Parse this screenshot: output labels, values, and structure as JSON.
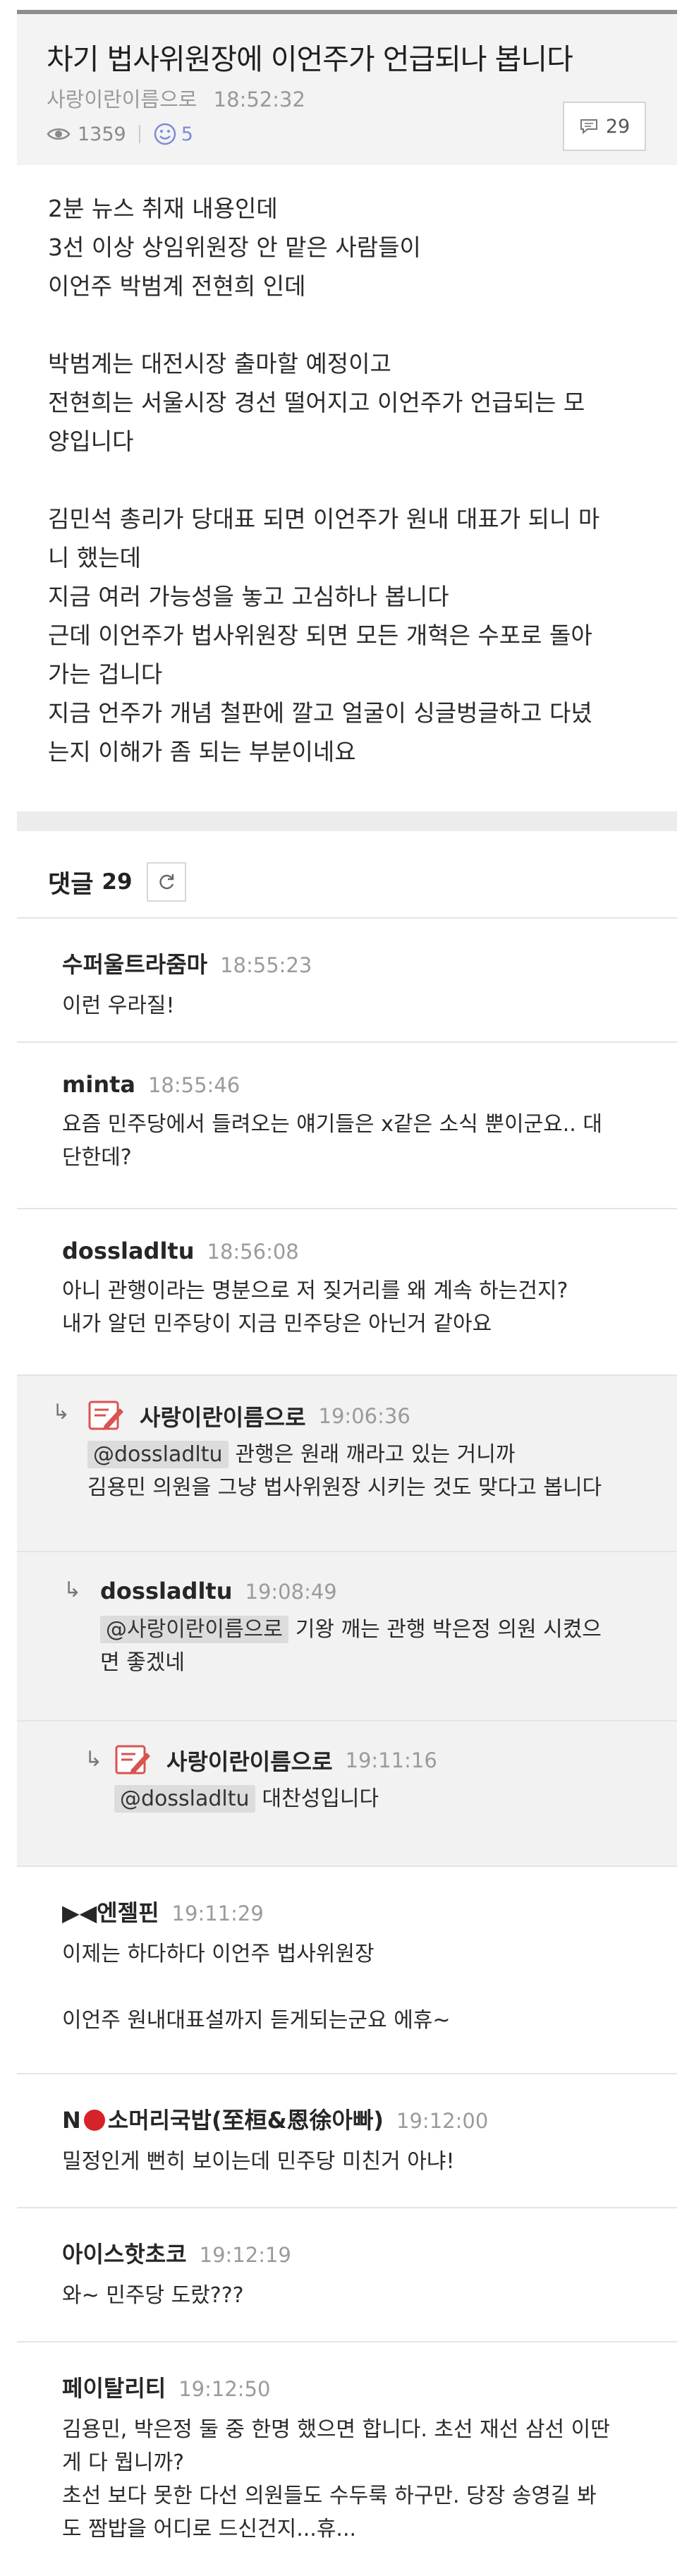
{
  "post": {
    "title": "차기 법사위원장에 이언주가 언급되나 봅니다",
    "author": "사랑이란이름으로",
    "time": "18:52:32",
    "views": "1359",
    "likes": "5",
    "comment_count": "29",
    "body": {
      "p1": [
        "2분 뉴스 취재 내용인데",
        "3선 이상 상임위원장 안 맡은 사람들이",
        "이언주 박범계 전현희 인데"
      ],
      "p2": [
        "박범계는 대전시장 출마할 예정이고",
        "전현희는 서울시장 경선 떨어지고 이언주가 언급되는 모",
        "양입니다"
      ],
      "p3": [
        "김민석 총리가 당대표 되면 이언주가 원내 대표가 되니 마",
        "니 했는데",
        "지금 여러 가능성을 놓고 고심하나 봅니다",
        "근데 이언주가 법사위원장 되면 모든 개혁은 수포로 돌아",
        "가는 겁니다",
        "지금 언주가 개념 철판에 깔고 얼굴이 싱글벙글하고 다녔",
        "는지 이해가 좀 되는 부분이네요"
      ]
    }
  },
  "comments_header": {
    "title": "댓글",
    "count": "29"
  },
  "comments": [
    {
      "name": "수퍼울트라줌마",
      "time": "18:55:23",
      "lines": [
        "이런 우라질!"
      ]
    },
    {
      "name": "minta",
      "time": "18:55:46",
      "lines": [
        "요즘 민주당에서 들려오는 얘기들은 x같은 소식 뿐이군요.. 대",
        "단한데?"
      ]
    },
    {
      "name": "dossladltu",
      "time": "18:56:08",
      "lines": [
        "아니 관행이라는 명분으로 저 짖거리를 왜 계속 하는건지?",
        "내가 알던 민주당이 지금 민주당은 아닌거 같아요"
      ]
    },
    {
      "name": "사랑이란이름으로",
      "time": "19:06:36",
      "mention": "@dossladltu",
      "lines": [
        "관행은 원래 깨라고 있는 거니까",
        "김용민 의원을 그냥 법사위원장 시키는 것도 맞다고 봅니다"
      ]
    },
    {
      "name": "dossladltu",
      "time": "19:08:49",
      "mention": "@사랑이란이름으로",
      "lines": [
        "기왕 깨는 관행 박은정 의원 시켰으",
        "면 좋겠네"
      ]
    },
    {
      "name": "사랑이란이름으로",
      "time": "19:11:16",
      "mention": "@dossladltu",
      "lines": [
        "대찬성입니다"
      ]
    },
    {
      "name": "▶◀엔젤핀",
      "time": "19:11:29",
      "lines": [
        "이제는 하다하다 이언주 법사위원장",
        "",
        "이언주 원내대표설까지 듣게되는군요 에휴~"
      ]
    },
    {
      "name_prefix": "N",
      "name_suffix": "소머리국밥(至桓&恩徐아빠)",
      "time": "19:12:00",
      "lines": [
        "밀정인게 뻔히 보이는데 민주당 미친거 아냐!"
      ]
    },
    {
      "name": "아이스핫초코",
      "time": "19:12:19",
      "lines": [
        "와~ 민주당 도랐???"
      ]
    },
    {
      "name": "페이탈리티",
      "time": "19:12:50",
      "lines": [
        "김용민, 박은정 둘 중 한명 했으면 합니다. 초선 재선 삼선 이딴",
        "게 다 뭡니까?",
        "초선 보다 못한 다선 의원들도 수두룩 하구만. 당장 송영길 봐",
        "도 짬밥을 어디로 드신건지...휴..."
      ]
    }
  ],
  "icons": {
    "views": "eye-icon",
    "likes": "smile-icon",
    "comments": "speech-bubble-icon",
    "refresh": "refresh-icon",
    "author_badge": "pencil-badge-icon",
    "reply": "reply-arrow-icon"
  },
  "colors": {
    "accent_like": "#7f8bd8",
    "badge_red": "#d9534f",
    "dot_red": "#d4242a"
  }
}
